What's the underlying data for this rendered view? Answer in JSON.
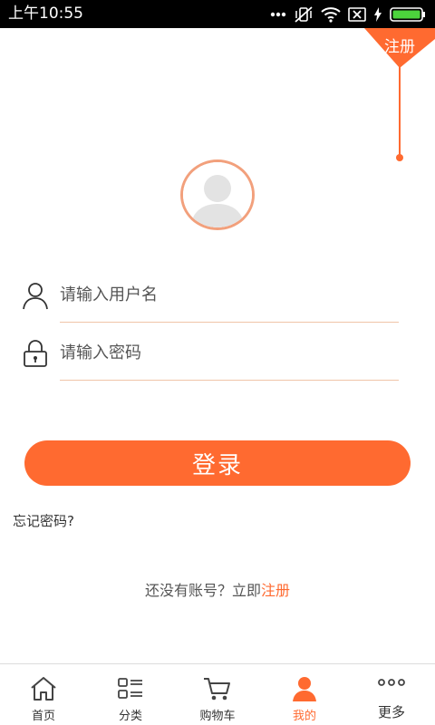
{
  "status_bar": {
    "time": "上午10:55"
  },
  "colors": {
    "accent": "#ff6a30",
    "avatar_border": "#f2a07c"
  },
  "register_ribbon": {
    "label": "注册"
  },
  "login_form": {
    "username_placeholder": "请输入用户名",
    "password_placeholder": "请输入密码",
    "login_button": "登录",
    "forgot_password": "忘记密码?",
    "no_account_prompt": "还没有账号？立即",
    "register_link": "注册"
  },
  "tab_bar": {
    "items": [
      {
        "label": "首页",
        "icon": "home-icon",
        "active": false
      },
      {
        "label": "分类",
        "icon": "category-icon",
        "active": false
      },
      {
        "label": "购物车",
        "icon": "cart-icon",
        "active": false
      },
      {
        "label": "我的",
        "icon": "user-icon",
        "active": true
      },
      {
        "label": "更多",
        "icon": "more-icon",
        "active": false
      }
    ]
  }
}
